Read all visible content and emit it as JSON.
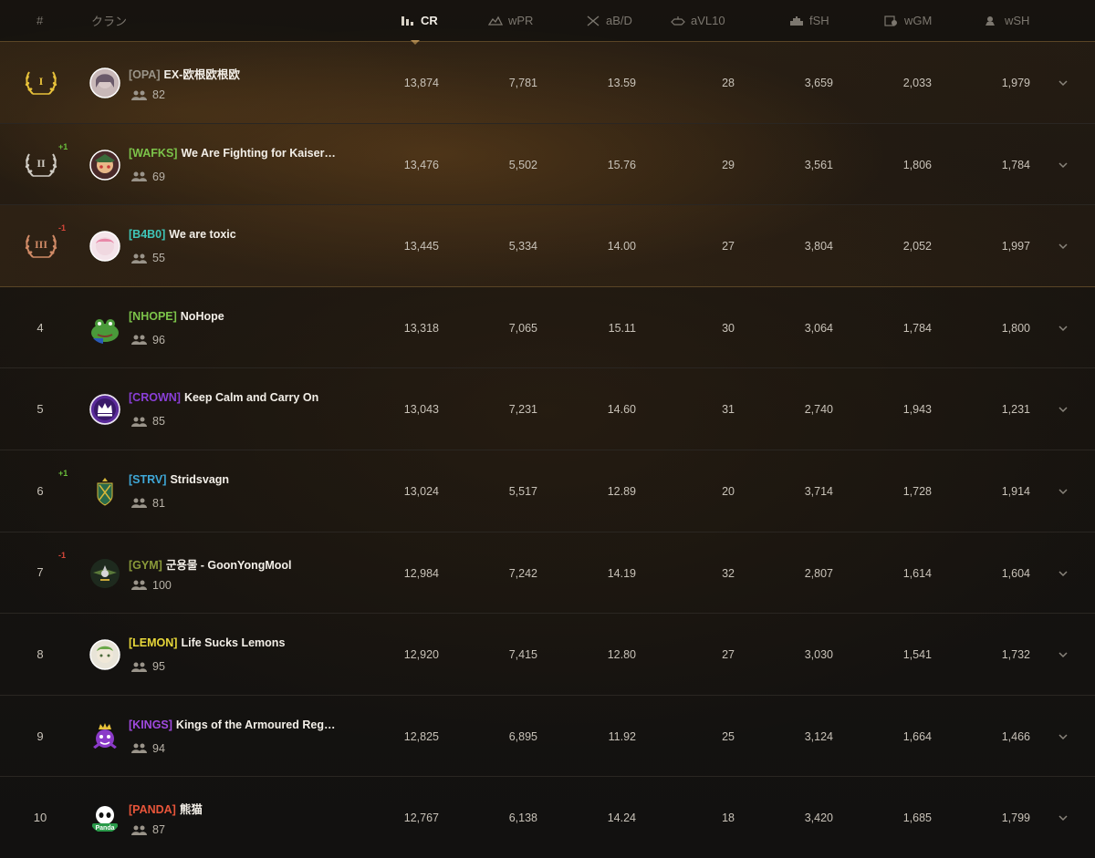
{
  "header": {
    "rank": "#",
    "clan": "クラン",
    "cr": "CR",
    "wpr": "wPR",
    "abd": "aB/D",
    "avl10": "aVL10",
    "fsh": "fSH",
    "wgm": "wGM",
    "wsh": "wSH"
  },
  "colors": {
    "gold": "#e8c23a",
    "silver": "#d0ccc4",
    "bronze": "#d08a66",
    "up": "#6abf3c",
    "down": "#d6473a"
  },
  "rows": [
    {
      "rank": "",
      "medal": "gold",
      "roman": "I",
      "delta": "",
      "tag": "[OPA]",
      "tag_color": "#9a9488",
      "name": "EX-欧根欧根欧",
      "members": "82",
      "cr": "13,874",
      "wpr": "7,781",
      "abd": "13.59",
      "avl10": "28",
      "fsh": "3,659",
      "wgm": "2,033",
      "wsh": "1,979",
      "emblem": "avatar-girl-icon"
    },
    {
      "rank": "",
      "medal": "silver",
      "roman": "II",
      "delta": "+1",
      "tag": "[WAFKS]",
      "tag_color": "#7cc44a",
      "name": "We Are Fighting for Kaiser…",
      "members": "69",
      "cr": "13,476",
      "wpr": "5,502",
      "abd": "15.76",
      "avl10": "29",
      "fsh": "3,561",
      "wgm": "1,806",
      "wsh": "1,784",
      "emblem": "avatar-anime-icon"
    },
    {
      "rank": "",
      "medal": "bronze",
      "roman": "III",
      "delta": "-1",
      "tag": "[B4B0]",
      "tag_color": "#3fc6b8",
      "name": "We are toxic",
      "members": "55",
      "cr": "13,445",
      "wpr": "5,334",
      "abd": "14.00",
      "avl10": "27",
      "fsh": "3,804",
      "wgm": "2,052",
      "wsh": "1,997",
      "emblem": "avatar-pink-icon"
    },
    {
      "rank": "4",
      "medal": "",
      "roman": "",
      "delta": "",
      "tag": "[NHOPE]",
      "tag_color": "#7cc44a",
      "name": "NoHope",
      "members": "96",
      "cr": "13,318",
      "wpr": "7,065",
      "abd": "15.11",
      "avl10": "30",
      "fsh": "3,064",
      "wgm": "1,784",
      "wsh": "1,800",
      "emblem": "frog-icon"
    },
    {
      "rank": "5",
      "medal": "",
      "roman": "",
      "delta": "",
      "tag": "[CROWN]",
      "tag_color": "#8a3fd8",
      "name": "Keep Calm and Carry On",
      "members": "85",
      "cr": "13,043",
      "wpr": "7,231",
      "abd": "14.60",
      "avl10": "31",
      "fsh": "2,740",
      "wgm": "1,943",
      "wsh": "1,231",
      "emblem": "crown-icon"
    },
    {
      "rank": "6",
      "medal": "",
      "roman": "",
      "delta": "+1",
      "tag": "[STRV]",
      "tag_color": "#3fa8d8",
      "name": "Stridsvagn",
      "members": "81",
      "cr": "13,024",
      "wpr": "5,517",
      "abd": "12.89",
      "avl10": "20",
      "fsh": "3,714",
      "wgm": "1,728",
      "wsh": "1,914",
      "emblem": "shield-crest-icon"
    },
    {
      "rank": "7",
      "medal": "",
      "roman": "",
      "delta": "-1",
      "tag": "[GYM]",
      "tag_color": "#8a9a3a",
      "name": "군용물 - GoonYongMool",
      "members": "100",
      "cr": "12,984",
      "wpr": "7,242",
      "abd": "14.19",
      "avl10": "32",
      "fsh": "2,807",
      "wgm": "1,614",
      "wsh": "1,604",
      "emblem": "military-badge-icon"
    },
    {
      "rank": "8",
      "medal": "",
      "roman": "",
      "delta": "",
      "tag": "[LEMON]",
      "tag_color": "#e8d83a",
      "name": "Life Sucks Lemons",
      "members": "95",
      "cr": "12,920",
      "wpr": "7,415",
      "abd": "12.80",
      "avl10": "27",
      "fsh": "3,030",
      "wgm": "1,541",
      "wsh": "1,732",
      "emblem": "avatar-lemon-icon"
    },
    {
      "rank": "9",
      "medal": "",
      "roman": "",
      "delta": "",
      "tag": "[KINGS]",
      "tag_color": "#a04ae0",
      "name": "Kings of the Armoured Reg…",
      "members": "94",
      "cr": "12,825",
      "wpr": "6,895",
      "abd": "11.92",
      "avl10": "25",
      "fsh": "3,124",
      "wgm": "1,664",
      "wsh": "1,466",
      "emblem": "king-icon"
    },
    {
      "rank": "10",
      "medal": "",
      "roman": "",
      "delta": "",
      "tag": "[PANDA]",
      "tag_color": "#e8553a",
      "name": "熊猫",
      "members": "87",
      "cr": "12,767",
      "wpr": "6,138",
      "abd": "14.24",
      "avl10": "18",
      "fsh": "3,420",
      "wgm": "1,685",
      "wsh": "1,799",
      "emblem": "panda-icon",
      "emblem_text": "Panda"
    }
  ]
}
